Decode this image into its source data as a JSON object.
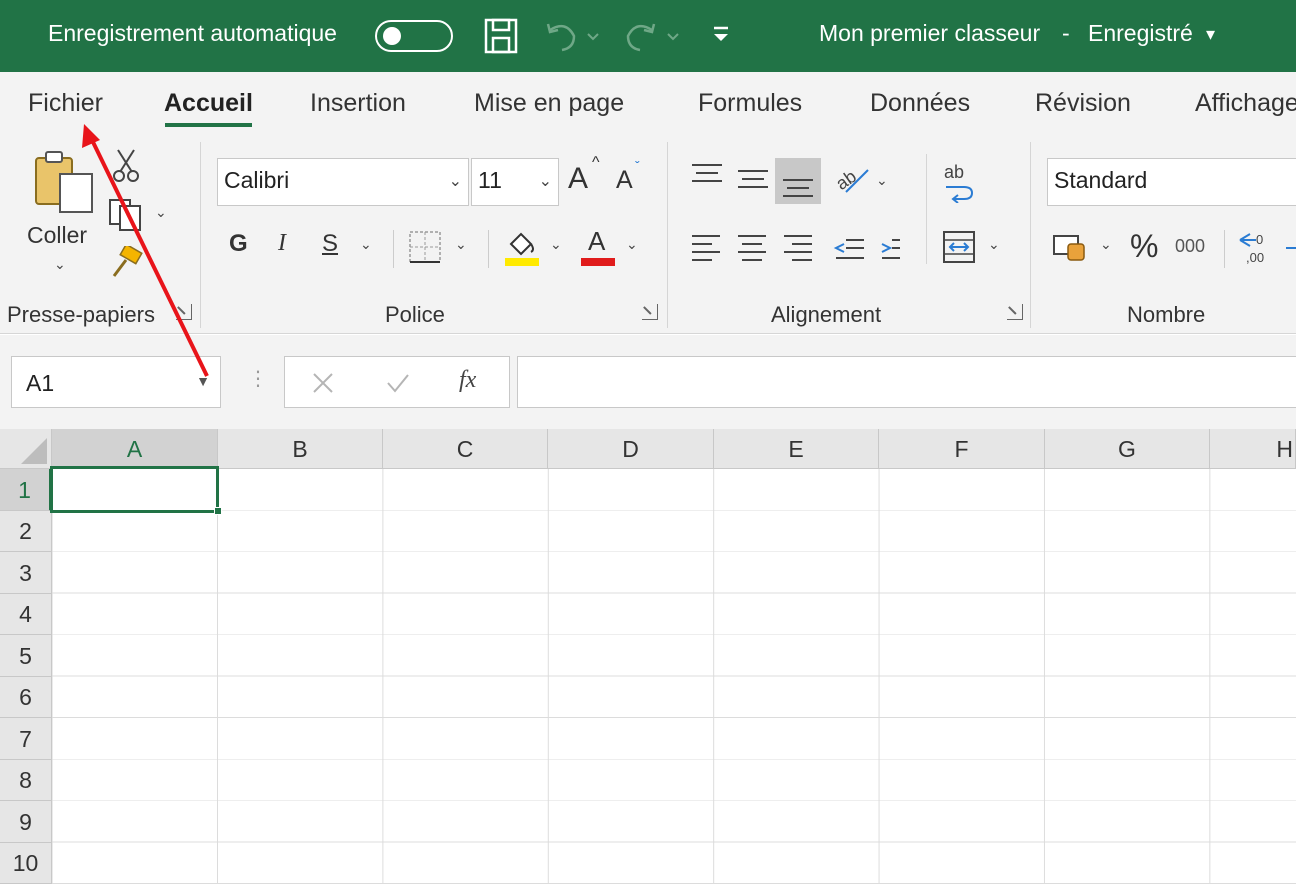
{
  "titlebar": {
    "autosave_label": "Enregistrement automatique",
    "doc_title": "Mon premier classeur",
    "title_sep": "-",
    "save_status": "Enregistré",
    "caret": "▾"
  },
  "tabs": [
    "Fichier",
    "Accueil",
    "Insertion",
    "Mise en page",
    "Formules",
    "Données",
    "Révision",
    "Affichage"
  ],
  "active_tab": "Accueil",
  "ribbon": {
    "clipboard": {
      "paste_label": "Coller",
      "group_label": "Presse-papiers"
    },
    "font": {
      "family": "Calibri",
      "size": "11",
      "grow": "A",
      "shrink": "A",
      "bold": "G",
      "italic": "I",
      "underline": "S",
      "font_color_letter": "A",
      "group_label": "Police"
    },
    "alignment": {
      "group_label": "Alignement",
      "wrap_icon_text": "ab"
    },
    "number": {
      "format": "Standard",
      "percent": "%",
      "thousands": "000",
      "group_label": "Nombre"
    }
  },
  "formula_bar": {
    "name_box": "A1",
    "fx": "fx",
    "value": ""
  },
  "grid": {
    "columns": [
      "A",
      "B",
      "C",
      "D",
      "E",
      "F",
      "G",
      "H"
    ],
    "rows": [
      "1",
      "2",
      "3",
      "4",
      "5",
      "6",
      "7",
      "8",
      "9",
      "10"
    ],
    "selected_cell": "A1"
  },
  "colors": {
    "accent": "#217346",
    "arrow": "#e8141a",
    "fill_yellow": "#ffea00",
    "font_red": "#e01b1b"
  }
}
